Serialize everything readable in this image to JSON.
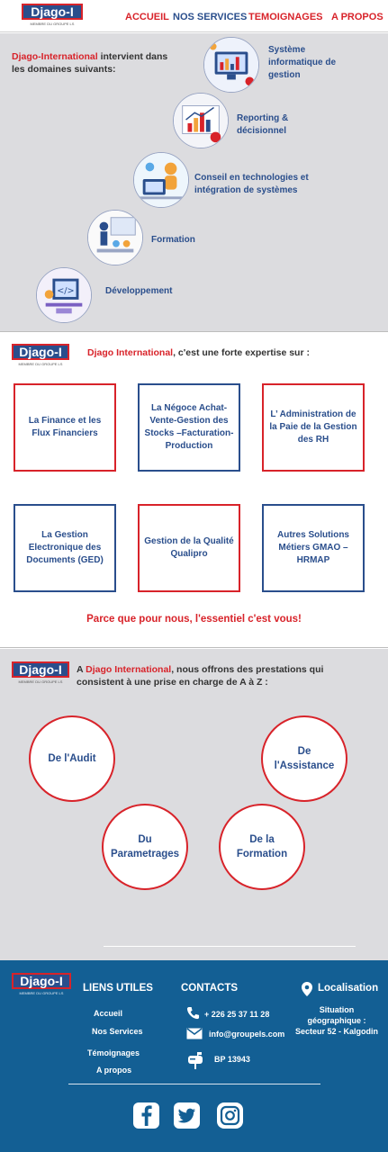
{
  "header": {
    "logo_text": "Djago-I",
    "logo_subtitle": "MEMBRE DU GROUPE LS",
    "nav": [
      "ACCUEIL",
      "NOS SERVICES",
      "TEMOIGNAGES",
      "A PROPOS"
    ]
  },
  "domains": {
    "intro_brand": "Djago-International",
    "intro_rest": " intervient dans les domaines suivants:",
    "items": [
      {
        "label": "Système informatique de gestion",
        "icon": "it-management-icon"
      },
      {
        "label": "Reporting & décisionnel",
        "icon": "reporting-icon"
      },
      {
        "label": "Conseil en technologies et intégration de systèmes",
        "icon": "consulting-icon"
      },
      {
        "label": "Formation",
        "icon": "training-icon"
      },
      {
        "label": "Développement",
        "icon": "development-icon"
      }
    ]
  },
  "expertise": {
    "logo_text": "Djago-I",
    "logo_subtitle": "MEMBRE DU GROUPE LS",
    "title_brand": "Djago International",
    "title_rest": ", c'est  une forte expertise sur :",
    "items": [
      "La Finance et les Flux Financiers",
      "La Négoce Achat-Vente-Gestion des Stocks –Facturation-Production",
      "L’ Administration de la Paie de la Gestion des RH",
      "La Gestion Electronique des Documents (GED)",
      "Gestion de la Qualité Qualipro",
      "Autres Solutions Métiers GMAO – HRMAP"
    ],
    "tagline": "Parce que pour nous, l'essentiel c'est vous!"
  },
  "services": {
    "logo_text": "Djago-I",
    "logo_subtitle": "MEMBRE DU GROUPE LS",
    "title_prefix": "A ",
    "title_brand": "Djago International",
    "title_rest": ", nous offrons des prestations qui consistent à  une prise en charge de A à Z :",
    "items": [
      "De l'Audit",
      "De l'Assistance",
      "Du Parametrages",
      "De la Formation"
    ]
  },
  "footer": {
    "logo_text": "Djago-I",
    "logo_subtitle": "MEMBRE DU GROUPE LS",
    "links_title": "LIENS UTILES",
    "links": [
      "Accueil",
      "Nos Services",
      "Témoignages",
      "A propos"
    ],
    "contacts_title": "CONTACTS",
    "phone": "+ 226 25 37 11 28",
    "email": "info@groupels.com",
    "po_box": "BP 13943",
    "location_title": "Localisation",
    "location_text": "Situation géographique : Secteur 52 - Kalgodin",
    "social": [
      "facebook-icon",
      "twitter-icon",
      "instagram-icon"
    ]
  },
  "colors": {
    "brand_blue": "#2a4e8c",
    "brand_red": "#d8232a",
    "footer_blue": "#135f94",
    "section_gray": "#dcdcdf"
  }
}
